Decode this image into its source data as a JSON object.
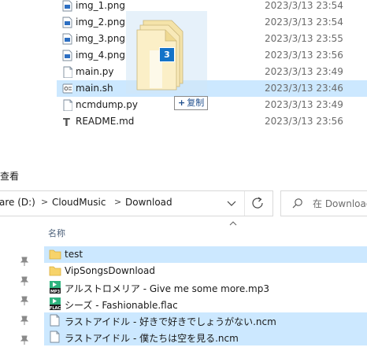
{
  "top_files": [
    {
      "name": "img_1.png",
      "date": "2023/3/13 23:54",
      "icon": "image-file-icon",
      "selected": false
    },
    {
      "name": "img_2.png",
      "date": "2023/3/13 23:54",
      "icon": "image-file-icon",
      "selected": false
    },
    {
      "name": "img_3.png",
      "date": "2023/3/13 23:55",
      "icon": "image-file-icon",
      "selected": false
    },
    {
      "name": "img_4.png",
      "date": "2023/3/13 23:56",
      "icon": "image-file-icon",
      "selected": false
    },
    {
      "name": "main.py",
      "date": "2023/3/13 23:49",
      "icon": "file-icon",
      "selected": false
    },
    {
      "name": "main.sh",
      "date": "2023/3/13 23:46",
      "icon": "script-file-icon",
      "selected": true
    },
    {
      "name": "ncmdump.py",
      "date": "2023/3/13 23:49",
      "icon": "file-icon",
      "selected": false
    },
    {
      "name": "README.md",
      "date": "2023/3/13 23:56",
      "icon": "text-file-icon",
      "selected": false
    }
  ],
  "drag": {
    "count": "3",
    "tooltip": "复制",
    "tooltip_icon": "+"
  },
  "menu": {
    "view_label": "查看"
  },
  "address": {
    "crumbs": [
      "are (D:)",
      "CloudMusic",
      "Download"
    ],
    "separator": ">"
  },
  "search": {
    "placeholder": "在 Download"
  },
  "list_header": {
    "name": "名称"
  },
  "bottom_files": [
    {
      "name": "test",
      "icon": "folder-icon",
      "selected": true
    },
    {
      "name": "VipSongsDownload",
      "icon": "folder-icon",
      "selected": false
    },
    {
      "name": "アルストロメリア - Give me some more.mp3",
      "icon": "mp3-file-icon",
      "selected": false
    },
    {
      "name": "シーズ - Fashionable.flac",
      "icon": "flac-file-icon",
      "selected": false
    },
    {
      "name": "ラストアイドル - 好きで好きでしょうがない.ncm",
      "icon": "file-icon",
      "selected": true
    },
    {
      "name": "ラストアイドル - 僕たちは空を見る.ncm",
      "icon": "file-icon",
      "selected": true
    }
  ],
  "colors": {
    "selection": "#cce8ff",
    "folder": "#f7d36a",
    "accent": "#1473c8",
    "media_green": "#2fb37e"
  }
}
